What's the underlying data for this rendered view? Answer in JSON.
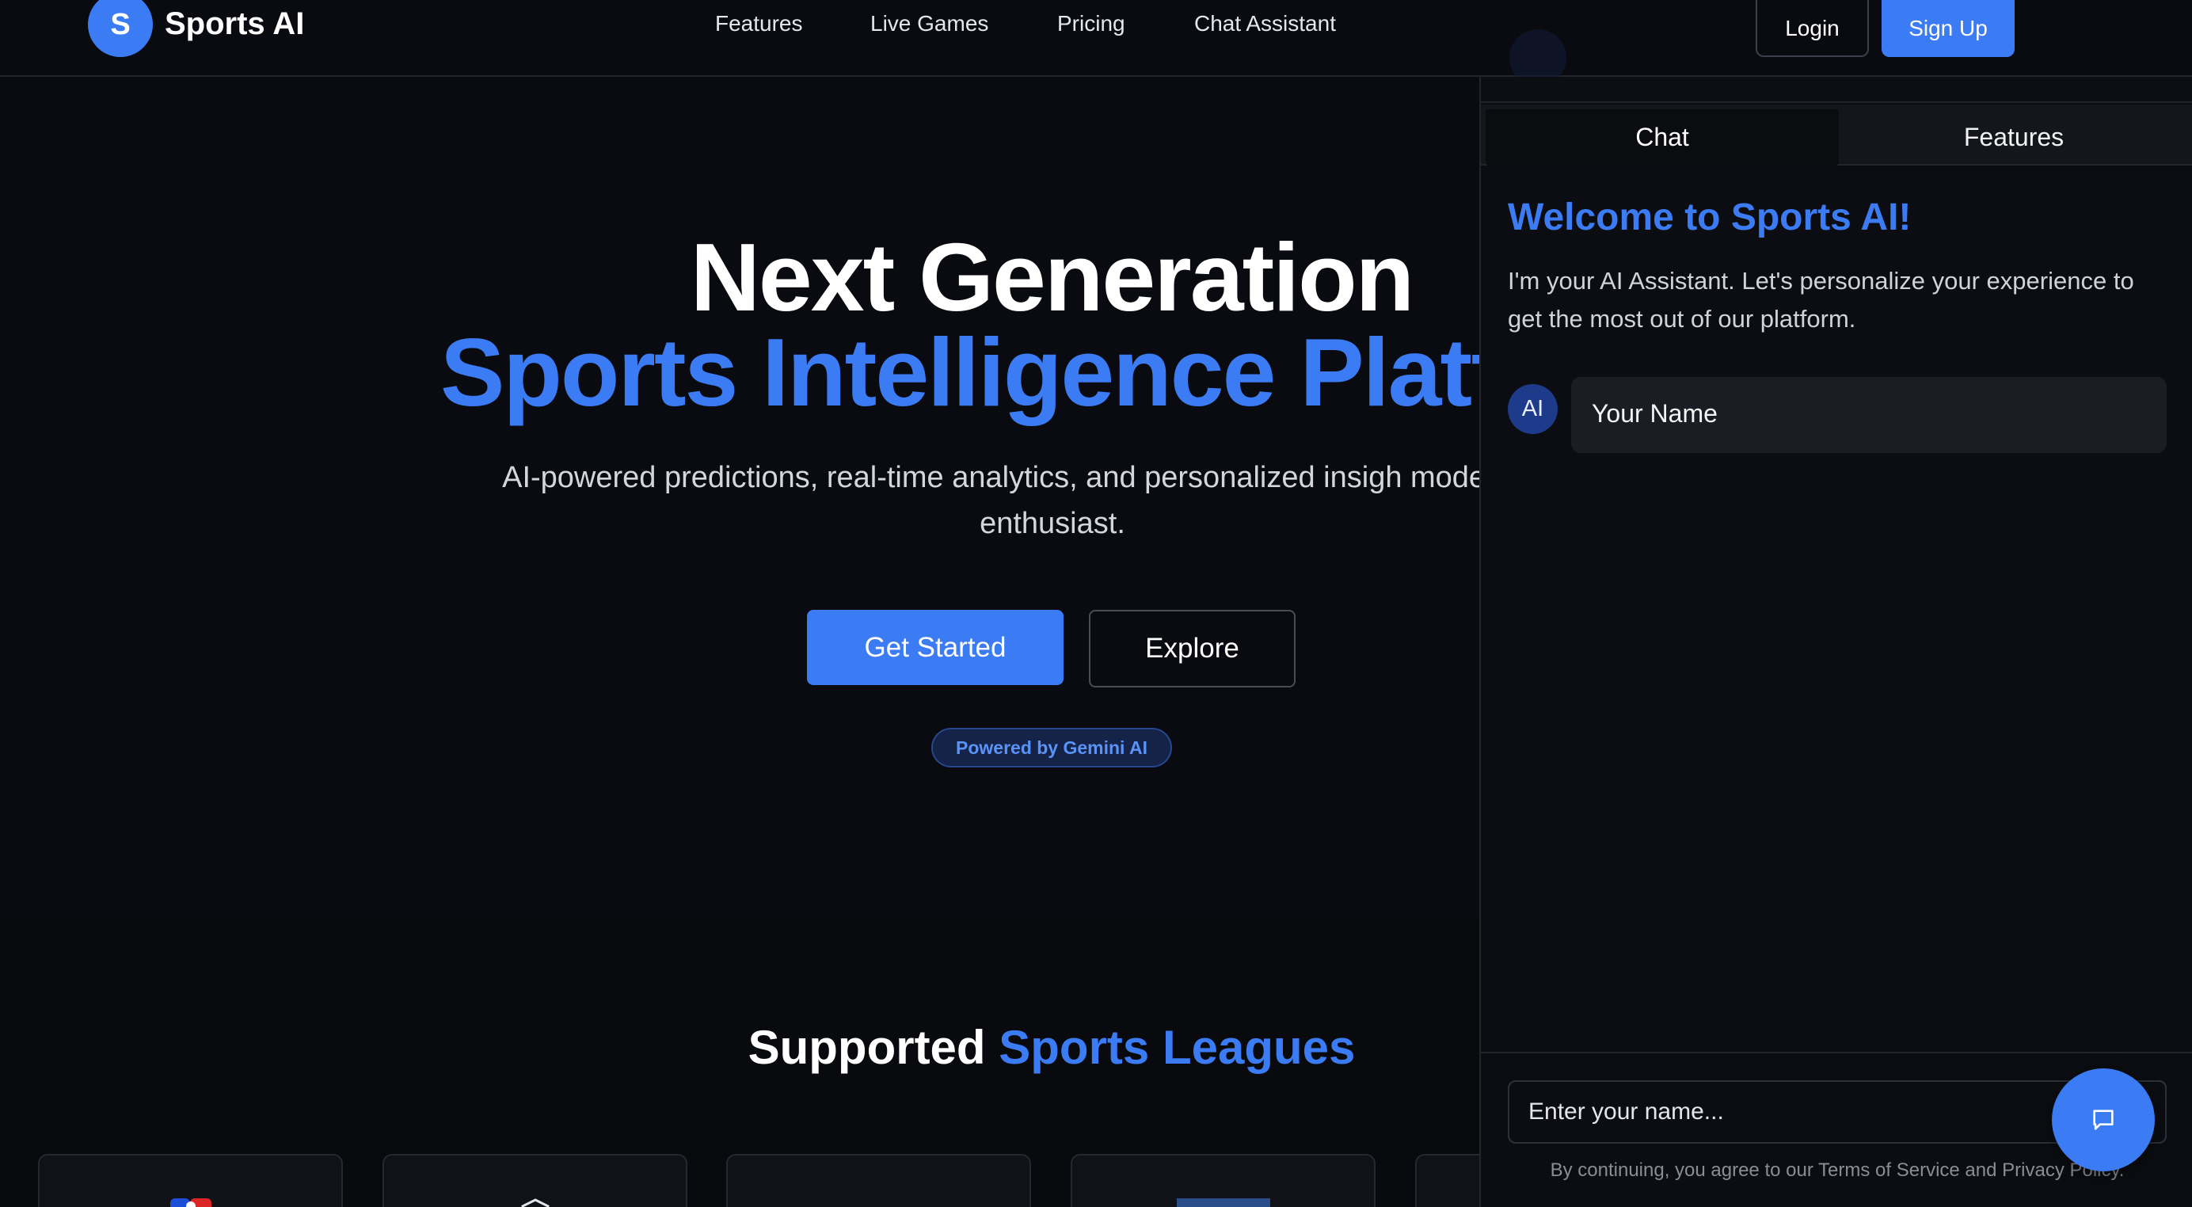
{
  "brand": {
    "logo_letter": "S",
    "name": "Sports AI"
  },
  "nav": {
    "items": [
      {
        "label": "Features"
      },
      {
        "label": "Live Games"
      },
      {
        "label": "Pricing"
      },
      {
        "label": "Chat Assistant"
      }
    ],
    "login_label": "Login",
    "signup_label": "Sign Up"
  },
  "hero": {
    "title_line1": "Next Generation",
    "title_line2": "Sports Intelligence Platf",
    "subtitle": "AI-powered predictions, real-time analytics, and personalized insigh modern sports enthusiast.",
    "get_started_label": "Get Started",
    "explore_label": "Explore",
    "badge": "Powered by Gemini AI"
  },
  "leagues": {
    "title_plain": "Supported ",
    "title_highlight": "Sports Leagues"
  },
  "chat": {
    "tabs": [
      {
        "label": "Chat",
        "active": true
      },
      {
        "label": "Features",
        "active": false
      }
    ],
    "welcome": "Welcome to Sports AI!",
    "intro": "I'm your AI Assistant. Let's personalize your experience to get the most out of our platform.",
    "avatar_label": "AI",
    "message": "Your Name",
    "input_placeholder": "Enter your name...",
    "terms": "By continuing, you agree to our Terms of Service and Privacy Policy."
  },
  "colors": {
    "accent": "#3b7cf5",
    "background": "#0a0b10",
    "panel": "#0c0d12",
    "badge_bg": "#142347"
  },
  "icons": {
    "fab": "chat-bubble-icon"
  }
}
